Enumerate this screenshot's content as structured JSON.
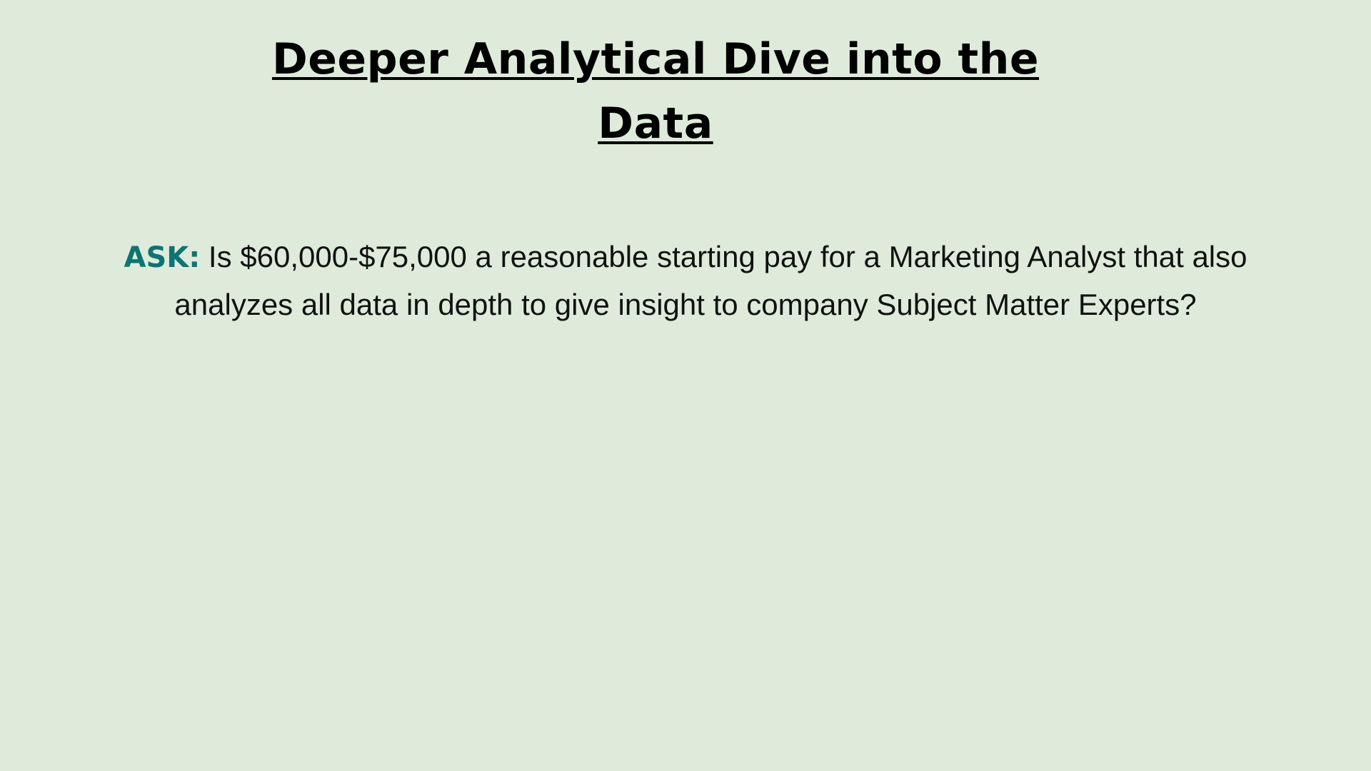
{
  "slide": {
    "title": "Deeper Analytical Dive into the Data",
    "ask_label": "ASK:",
    "ask_text": "Is $60,000-$75,000 a reasonable starting pay for a Marketing Analyst that also analyzes all data in depth to give insight  to company Subject Matter Experts?"
  },
  "colors": {
    "background": "#deebdb",
    "ask_accent": "#0e7373",
    "text": "#000000"
  }
}
